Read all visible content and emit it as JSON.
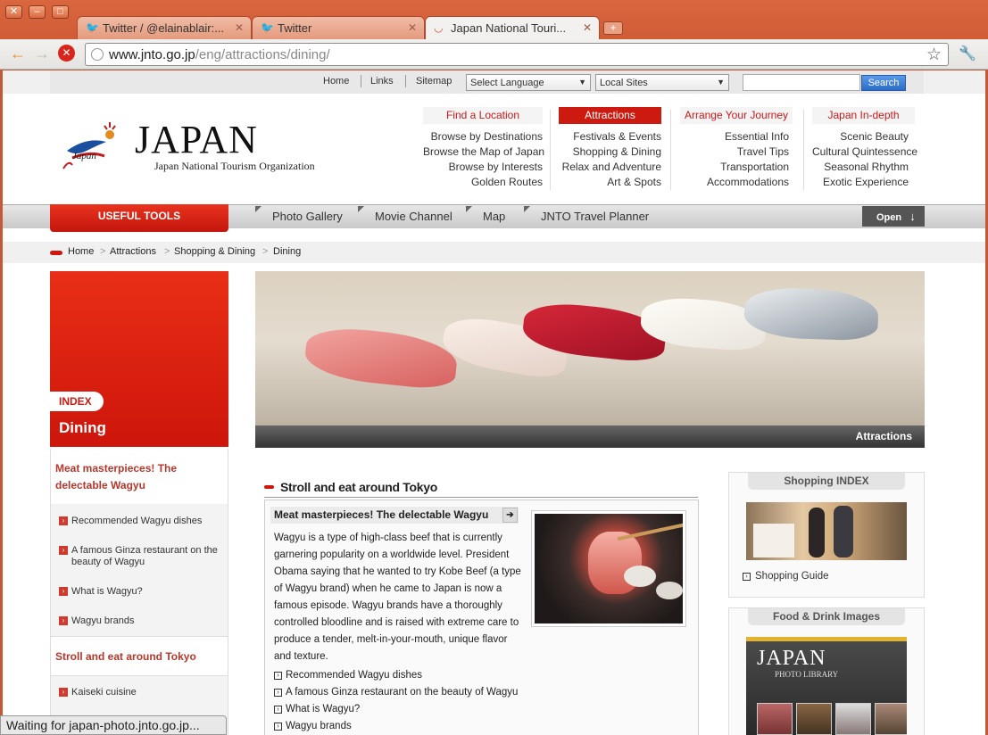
{
  "browser": {
    "tabs": [
      {
        "label": "Twitter / @elainablair:...",
        "icon": "twitter-bird-icon"
      },
      {
        "label": "Twitter",
        "icon": "twitter-bird-icon"
      },
      {
        "label": "Japan National Touri...",
        "icon": "loading-spinner-icon"
      }
    ],
    "url_host": "www.jnto.go.jp",
    "url_path": "/eng/attractions/dining/",
    "status": "Waiting for japan-photo.jnto.go.jp..."
  },
  "util": {
    "links": [
      "Home",
      "Links",
      "Sitemap"
    ],
    "language_select": "Select Language",
    "local_sites_select": "Local Sites",
    "search_value": "",
    "search_button": "Search"
  },
  "logo": {
    "wordmark": "JAPAN",
    "script": "Japan",
    "org": "Japan National Tourism Organization"
  },
  "menu": [
    {
      "title": "Find a Location",
      "items": [
        "Browse by Destinations",
        "Browse the Map of Japan",
        "Browse by Interests",
        "Golden Routes"
      ]
    },
    {
      "title": "Attractions",
      "items": [
        "Festivals & Events",
        "Shopping & Dining",
        "Relax and Adventure",
        "Art & Spots"
      ]
    },
    {
      "title": "Arrange Your Journey",
      "items": [
        "Essential Info",
        "Travel Tips",
        "Transportation",
        "Accommodations"
      ]
    },
    {
      "title": "Japan In-depth",
      "items": [
        "Scenic Beauty",
        "Cultural Quintessence",
        "Seasonal Rhythm",
        "Exotic Experience"
      ]
    }
  ],
  "navbar": {
    "useful": "USEFUL TOOLS",
    "items": [
      "Photo Gallery",
      "Movie Channel",
      "Map",
      "JNTO Travel Planner"
    ],
    "open": "Open"
  },
  "breadcrumb": [
    "Home",
    "Attractions",
    "Shopping & Dining",
    "Dining"
  ],
  "left": {
    "index_badge": "INDEX",
    "title": "Dining",
    "section1": "Meat masterpieces! The delectable Wagyu",
    "section1_items": [
      "Recommended Wagyu dishes",
      "A famous Ginza restaurant on the beauty of Wagyu",
      "What is Wagyu?",
      "Wagyu brands"
    ],
    "section2": "Stroll and eat around Tokyo",
    "section2_items": [
      "Kaiseki cuisine"
    ]
  },
  "hero": {
    "caption": "Attractions"
  },
  "main": {
    "section_title": "Stroll and eat around Tokyo",
    "card_title": "Meat masterpieces! The delectable Wagyu",
    "card_text": "Wagyu is a type of high-class beef that is currently garnering popularity on a worldwide level. President Obama saying that he wanted to try Kobe Beef (a type of Wagyu brand) when he came to Japan is now a famous episode. Wagyu brands have a thoroughly controlled bloodline and is raised with extreme care to produce a tender, melt-in-your-mouth, unique flavor and texture.",
    "links": [
      "Recommended Wagyu dishes",
      "A famous Ginza restaurant on the beauty of Wagyu",
      "What is Wagyu?",
      "Wagyu brands"
    ]
  },
  "right": {
    "shopping_title": "Shopping INDEX",
    "shopping_link": "Shopping Guide",
    "food_title": "Food & Drink Images",
    "photolib_word": "JAPAN",
    "photolib_sub": "PHOTO LIBRARY"
  },
  "colors": {
    "accent": "#cc1a10",
    "chrome": "#d2603a"
  }
}
